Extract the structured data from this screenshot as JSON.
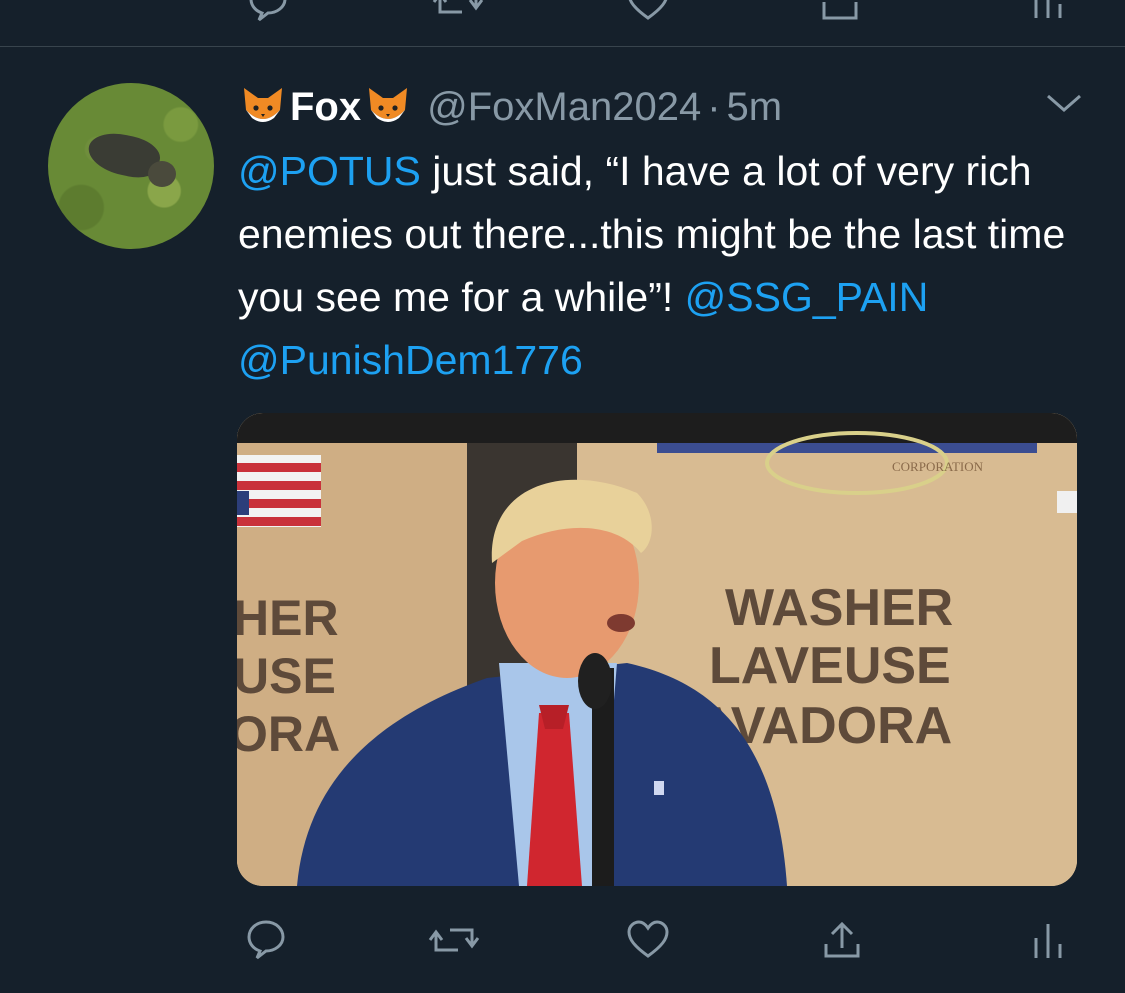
{
  "tweet": {
    "display_name": "Fox",
    "name_emoji": "fox-face-emoji",
    "handle": "@FoxMan2024",
    "separator": "·",
    "time": "5m",
    "text_parts": [
      {
        "text": "@POTUS",
        "type": "mention"
      },
      {
        "text": " just said, “I have a lot of very rich enemies out there...this might be the last time you see me for a while”! ",
        "type": "text"
      },
      {
        "text": "@SSG_PAIN",
        "type": "mention"
      },
      {
        "text": " ",
        "type": "text"
      },
      {
        "text": "@PunishDem1776",
        "type": "mention"
      }
    ],
    "media": {
      "signs": [
        "WASHER",
        "LAVEUSE",
        "AVADORA",
        "CORPORATION",
        "HER",
        "USE",
        "ORA"
      ]
    }
  },
  "actions": [
    {
      "name": "reply-icon"
    },
    {
      "name": "retweet-icon"
    },
    {
      "name": "like-icon"
    },
    {
      "name": "share-icon"
    },
    {
      "name": "analytics-icon"
    }
  ],
  "colors": {
    "background": "#15202b",
    "mention": "#1da1f2",
    "secondary_text": "#8899a6",
    "divider": "#38444d"
  }
}
